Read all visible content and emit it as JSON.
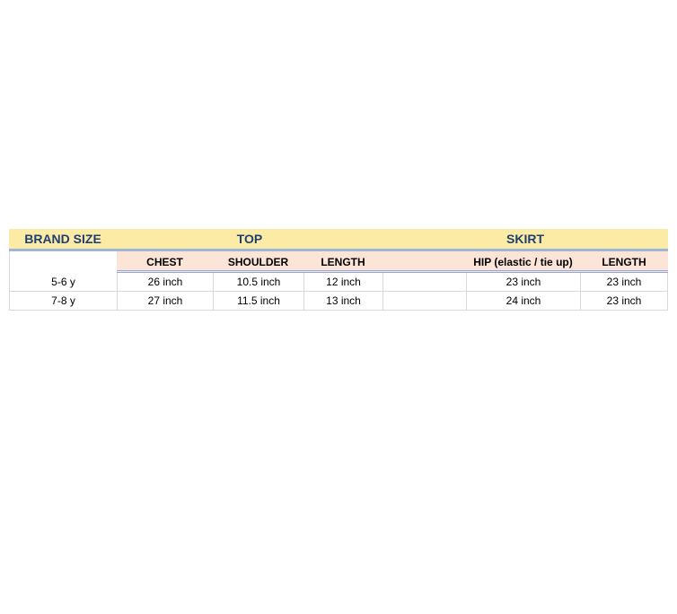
{
  "header": {
    "brand_size": "BRAND SIZE",
    "top": "TOP",
    "skirt": "SKIRT"
  },
  "subheader": {
    "chest": "CHEST",
    "shoulder": "SHOULDER",
    "top_length": "LENGTH",
    "hip": "HIP (elastic / tie up)",
    "skirt_length": "LENGTH"
  },
  "rows": [
    {
      "size": "5-6 y",
      "chest": "26 inch",
      "shoulder": "10.5 inch",
      "top_length": "12 inch",
      "hip": "23 inch",
      "skirt_length": "23 inch"
    },
    {
      "size": "7-8 y",
      "chest": "27 inch",
      "shoulder": "11.5 inch",
      "top_length": "13 inch",
      "hip": "24 inch",
      "skirt_length": "23 inch"
    }
  ],
  "colors": {
    "header_bg": "#fbeba4",
    "header_text": "#1f3f73",
    "subheader_bg": "#fce4d6",
    "accent_line": "#8ea9db"
  }
}
